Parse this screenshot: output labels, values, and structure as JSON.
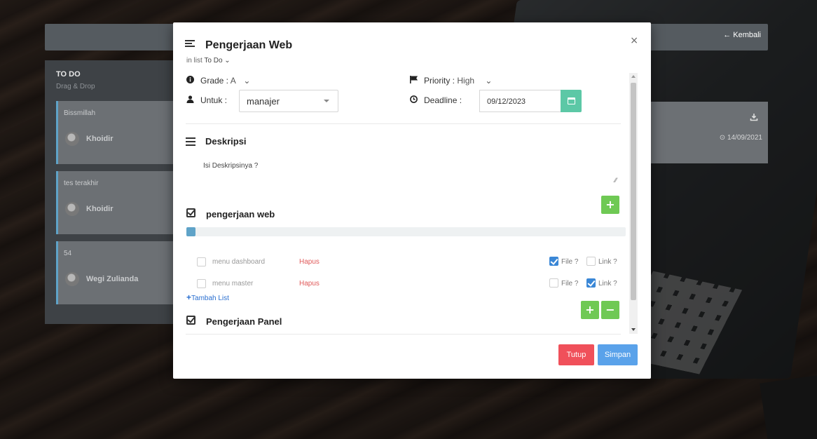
{
  "app": {
    "back_label": "← Kembali"
  },
  "board": {
    "column_title": "TO DO",
    "column_subtitle": "Drag & Drop",
    "cards": [
      {
        "title": "Bissmillah",
        "user": "Khoidir"
      },
      {
        "title": "tes terakhir",
        "user": "Khoidir"
      },
      {
        "title": "54",
        "user": "Wegi Zulianda"
      }
    ],
    "right_card_date": "⊙ 14/09/2021"
  },
  "modal": {
    "title": "Pengerjaan Web",
    "in_list_prefix": "in list ",
    "in_list_value": "To Do ⌄",
    "close": "×",
    "grade_label": "Grade :",
    "grade_value": "A",
    "grade_caret": "⌄",
    "priority_label": "Priority :",
    "priority_value": "High",
    "priority_caret": "⌄",
    "untuk_label": "Untuk :",
    "untuk_value": "manajer",
    "deadline_label": "Deadline :",
    "deadline_value": "09/12/2023",
    "description_title": "Deskripsi",
    "description_text": "Isi Deskripsinya ?",
    "checklists": [
      {
        "title": "pengerjaan web",
        "progress_pct": 2,
        "items": [
          {
            "label": "menu dashboard",
            "delete": "Hapus",
            "file_label": "File ?",
            "file_checked": true,
            "link_label": "Link ?",
            "link_checked": false
          },
          {
            "label": "menu master",
            "delete": "Hapus",
            "file_label": "File ?",
            "file_checked": false,
            "link_label": "Link ?",
            "link_checked": true
          }
        ],
        "add_label": "Tambah List"
      },
      {
        "title": "Pengerjaan Panel"
      }
    ],
    "add_symbol": "+",
    "remove_symbol": "−",
    "close_button": "Tutup",
    "save_button": "Simpan"
  },
  "colors": {
    "green": "#6fc954",
    "teal": "#5cc8a6",
    "red": "#f0505a",
    "blue": "#5aa2ea",
    "checkbox_on": "#3a87d6"
  }
}
